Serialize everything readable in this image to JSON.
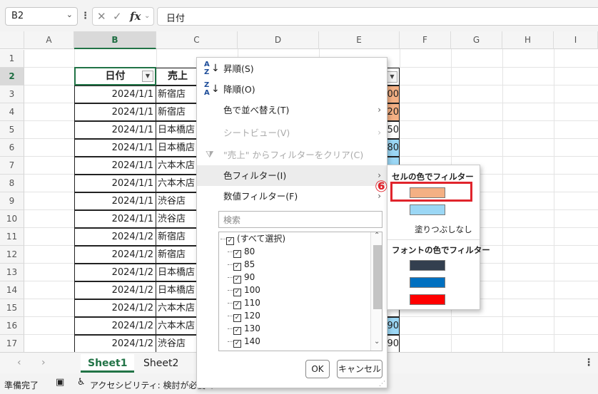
{
  "formula_bar": {
    "name_box": "B2",
    "fx": "fx",
    "value": "日付"
  },
  "columns": [
    "A",
    "B",
    "C",
    "D",
    "E",
    "F",
    "G",
    "H",
    "I"
  ],
  "rows": [
    "1",
    "2",
    "3",
    "4",
    "5",
    "6",
    "7",
    "8",
    "9",
    "10",
    "11",
    "12",
    "13",
    "14",
    "15",
    "16",
    "17"
  ],
  "headers": {
    "date": "日付",
    "store": "売上"
  },
  "data_rows": [
    {
      "date": "2024/1/1",
      "store": "新宿店",
      "e": "00",
      "e_color": "#f4b084"
    },
    {
      "date": "2024/1/1",
      "store": "新宿店",
      "e": "20",
      "e_color": "#f4b084"
    },
    {
      "date": "2024/1/1",
      "store": "日本橋店",
      "e": "50",
      "e_color": ""
    },
    {
      "date": "2024/1/1",
      "store": "日本橋店",
      "e": "80",
      "e_color": "#9bd7f5"
    },
    {
      "date": "2024/1/1",
      "store": "六本木店",
      "e": "",
      "e_color": "#9bd7f5"
    },
    {
      "date": "2024/1/1",
      "store": "六本木店",
      "e": "",
      "e_color": "#9bd7f5"
    },
    {
      "date": "2024/1/1",
      "store": "渋谷店",
      "e": "",
      "e_color": "#9bd7f5"
    },
    {
      "date": "2024/1/1",
      "store": "渋谷店",
      "e": "",
      "e_color": "#9bd7f5"
    },
    {
      "date": "2024/1/2",
      "store": "新宿店",
      "e": "",
      "e_color": ""
    },
    {
      "date": "2024/1/2",
      "store": "新宿店",
      "e": "",
      "e_color": ""
    },
    {
      "date": "2024/1/2",
      "store": "日本橋店",
      "e": "",
      "e_color": ""
    },
    {
      "date": "2024/1/2",
      "store": "日本橋店",
      "e": "",
      "e_color": ""
    },
    {
      "date": "2024/1/2",
      "store": "六本木店",
      "e": "",
      "e_color": ""
    },
    {
      "date": "2024/1/2",
      "store": "六本木店",
      "e": "90",
      "e_color": "#9bd7f5"
    },
    {
      "date": "2024/1/2",
      "store": "渋谷店",
      "e": "90",
      "e_color": ""
    }
  ],
  "menu": {
    "sort_asc": "昇順(S)",
    "sort_desc": "降順(O)",
    "sort_by_color": "色で並べ替え(T)",
    "sheet_view": "シートビュー(V)",
    "clear_filter": "\"売上\" からフィルターをクリア(C)",
    "color_filter": "色フィルター(I)",
    "number_filter": "数値フィルター(F)",
    "search_placeholder": "検索",
    "items": [
      "(すべて選択)",
      "80",
      "85",
      "90",
      "100",
      "110",
      "120",
      "130",
      "140"
    ],
    "ok": "OK",
    "cancel": "キャンセル"
  },
  "submenu": {
    "cell_color_title": "セルの色でフィルター",
    "cell_colors": [
      "#f4b084",
      "#9bd7f5"
    ],
    "no_fill": "塗りつぶしなし",
    "font_color_title": "フォントの色でフィルター",
    "font_colors": [
      "#333f4f",
      "#0070c0",
      "#ff0000"
    ]
  },
  "annotation": {
    "step": "⑥"
  },
  "tabs": [
    "Sheet1",
    "Sheet2"
  ],
  "status": {
    "ready": "準備完了",
    "accessibility": "アクセシビリティ: 検討が必要で"
  }
}
